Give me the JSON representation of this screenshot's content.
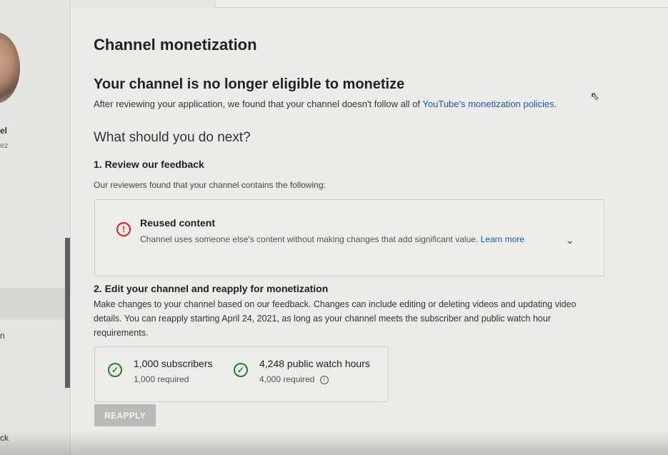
{
  "sidebar": {
    "channel_line1": "el",
    "channel_line2": "ez",
    "nav_fragment": "n",
    "bottom_fragment": "ck"
  },
  "page": {
    "title": "Channel monetization",
    "status_heading": "Your channel is no longer eligible to monetize",
    "status_text": "After reviewing your application, we found that your channel doesn't follow all of",
    "policy_link": "YouTube's monetization policies.",
    "next_heading": "What should you do next?"
  },
  "step1": {
    "title": "1. Review our feedback",
    "subtitle": "Our reviewers found that your channel contains the following:",
    "issue": {
      "title": "Reused content",
      "text": "Channel uses someone else's content without making changes that add significant value.",
      "link": "Learn more",
      "icon": "error-icon"
    }
  },
  "step2": {
    "title": "2. Edit your channel and reapply for monetization",
    "text": "Make changes to your channel based on our feedback. Changes can include editing or deleting videos and updating video details. You can reapply starting April 24, 2021, as long as your channel meets the subscriber and public watch hour requirements.",
    "requirements": [
      {
        "title": "1,000 subscribers",
        "sub": "1,000 required"
      },
      {
        "title": "4,248 public watch hours",
        "sub": "4,000 required"
      }
    ],
    "button": "REAPPLY"
  },
  "colors": {
    "link": "#1f56b8",
    "error": "#dd2222",
    "success": "#2a7a2a"
  }
}
